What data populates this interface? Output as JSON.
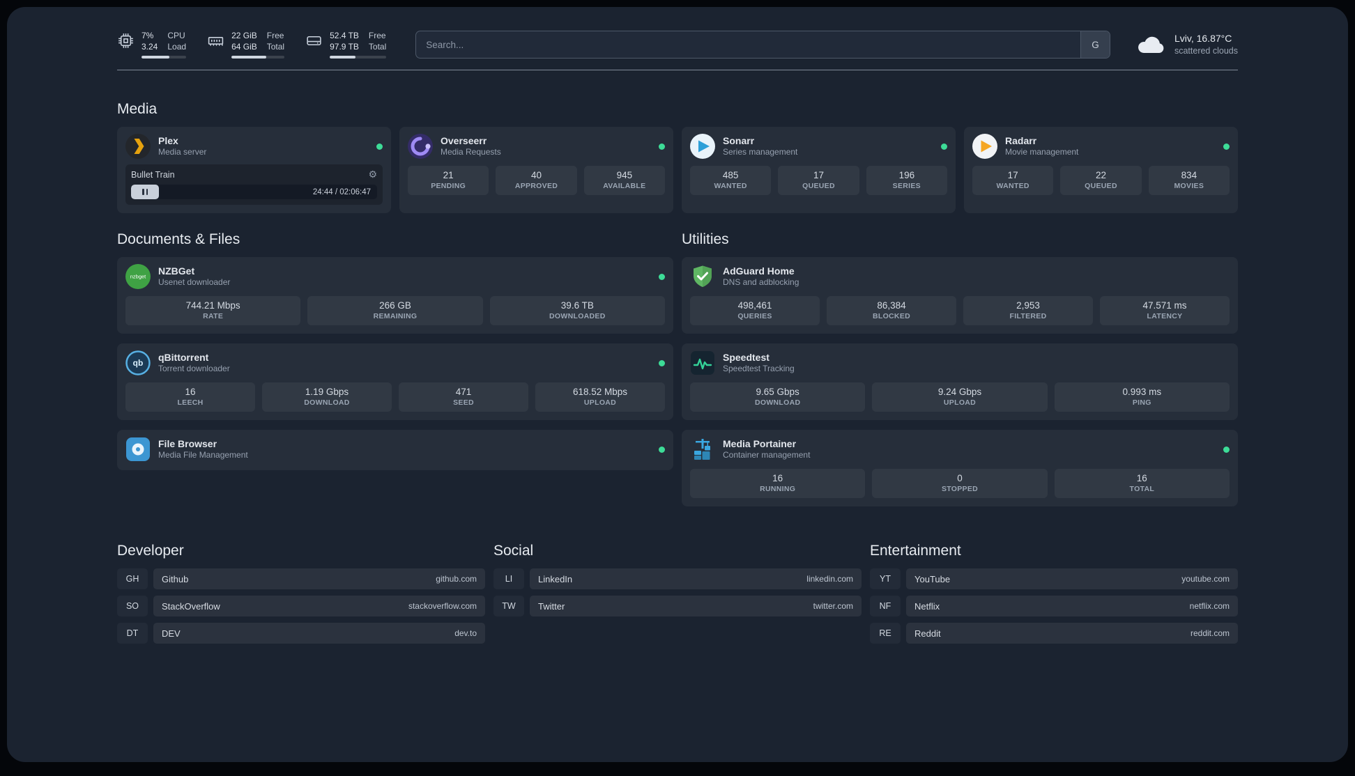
{
  "colors": {
    "status_online": "#3ddc97"
  },
  "icons": {
    "gear_glyph": "⚙"
  },
  "topbar": {
    "resources": [
      {
        "icon": "cpu-icon",
        "values": [
          "7%",
          "3.24"
        ],
        "labels": [
          "CPU",
          "Load"
        ],
        "bar_percent": 62
      },
      {
        "icon": "memory-icon",
        "values": [
          "22 GiB",
          "64 GiB"
        ],
        "labels": [
          "Free",
          "Total"
        ],
        "bar_percent": 66
      },
      {
        "icon": "disk-icon",
        "values": [
          "52.4 TB",
          "97.9 TB"
        ],
        "labels": [
          "Free",
          "Total"
        ],
        "bar_percent": 46
      }
    ],
    "search": {
      "placeholder": "Search...",
      "provider_label": "G"
    },
    "weather": {
      "location": "Lviv, 16.87°C",
      "condition": "scattered clouds"
    }
  },
  "sections": {
    "media": {
      "title": "Media"
    },
    "documents": {
      "title": "Documents & Files"
    },
    "utilities": {
      "title": "Utilities"
    }
  },
  "services": {
    "plex": {
      "name": "Plex",
      "subtitle": "Media server",
      "now_playing": "Bullet Train",
      "time": "24:44 / 02:06:47"
    },
    "overseerr": {
      "name": "Overseerr",
      "subtitle": "Media Requests",
      "stats": [
        {
          "value": "21",
          "label": "PENDING"
        },
        {
          "value": "40",
          "label": "APPROVED"
        },
        {
          "value": "945",
          "label": "AVAILABLE"
        }
      ]
    },
    "sonarr": {
      "name": "Sonarr",
      "subtitle": "Series management",
      "stats": [
        {
          "value": "485",
          "label": "WANTED"
        },
        {
          "value": "17",
          "label": "QUEUED"
        },
        {
          "value": "196",
          "label": "SERIES"
        }
      ]
    },
    "radarr": {
      "name": "Radarr",
      "subtitle": "Movie management",
      "stats": [
        {
          "value": "17",
          "label": "WANTED"
        },
        {
          "value": "22",
          "label": "QUEUED"
        },
        {
          "value": "834",
          "label": "MOVIES"
        }
      ]
    },
    "nzbget": {
      "name": "NZBGet",
      "subtitle": "Usenet downloader",
      "icon_text": "nzbget",
      "stats": [
        {
          "value": "744.21 Mbps",
          "label": "RATE"
        },
        {
          "value": "266 GB",
          "label": "REMAINING"
        },
        {
          "value": "39.6 TB",
          "label": "DOWNLOADED"
        }
      ]
    },
    "qbittorrent": {
      "name": "qBittorrent",
      "subtitle": "Torrent downloader",
      "icon_text": "qb",
      "stats": [
        {
          "value": "16",
          "label": "LEECH"
        },
        {
          "value": "1.19 Gbps",
          "label": "DOWNLOAD"
        },
        {
          "value": "471",
          "label": "SEED"
        },
        {
          "value": "618.52 Mbps",
          "label": "UPLOAD"
        }
      ]
    },
    "filebrowser": {
      "name": "File Browser",
      "subtitle": "Media File Management"
    },
    "adguard": {
      "name": "AdGuard Home",
      "subtitle": "DNS and adblocking",
      "stats": [
        {
          "value": "498,461",
          "label": "QUERIES"
        },
        {
          "value": "86,384",
          "label": "BLOCKED"
        },
        {
          "value": "2,953",
          "label": "FILTERED"
        },
        {
          "value": "47.571 ms",
          "label": "LATENCY"
        }
      ]
    },
    "speedtest": {
      "name": "Speedtest",
      "subtitle": "Speedtest Tracking",
      "stats": [
        {
          "value": "9.65 Gbps",
          "label": "DOWNLOAD"
        },
        {
          "value": "9.24 Gbps",
          "label": "UPLOAD"
        },
        {
          "value": "0.993 ms",
          "label": "PING"
        }
      ]
    },
    "portainer": {
      "name": "Media Portainer",
      "subtitle": "Container management",
      "stats": [
        {
          "value": "16",
          "label": "RUNNING"
        },
        {
          "value": "0",
          "label": "STOPPED"
        },
        {
          "value": "16",
          "label": "TOTAL"
        }
      ]
    }
  },
  "bookmarks": [
    {
      "title": "Developer",
      "items": [
        {
          "abbr": "GH",
          "name": "Github",
          "url": "github.com"
        },
        {
          "abbr": "SO",
          "name": "StackOverflow",
          "url": "stackoverflow.com"
        },
        {
          "abbr": "DT",
          "name": "DEV",
          "url": "dev.to"
        }
      ]
    },
    {
      "title": "Social",
      "items": [
        {
          "abbr": "LI",
          "name": "LinkedIn",
          "url": "linkedin.com"
        },
        {
          "abbr": "TW",
          "name": "Twitter",
          "url": "twitter.com"
        }
      ]
    },
    {
      "title": "Entertainment",
      "items": [
        {
          "abbr": "YT",
          "name": "YouTube",
          "url": "youtube.com"
        },
        {
          "abbr": "NF",
          "name": "Netflix",
          "url": "netflix.com"
        },
        {
          "abbr": "RE",
          "name": "Reddit",
          "url": "reddit.com"
        }
      ]
    }
  ]
}
